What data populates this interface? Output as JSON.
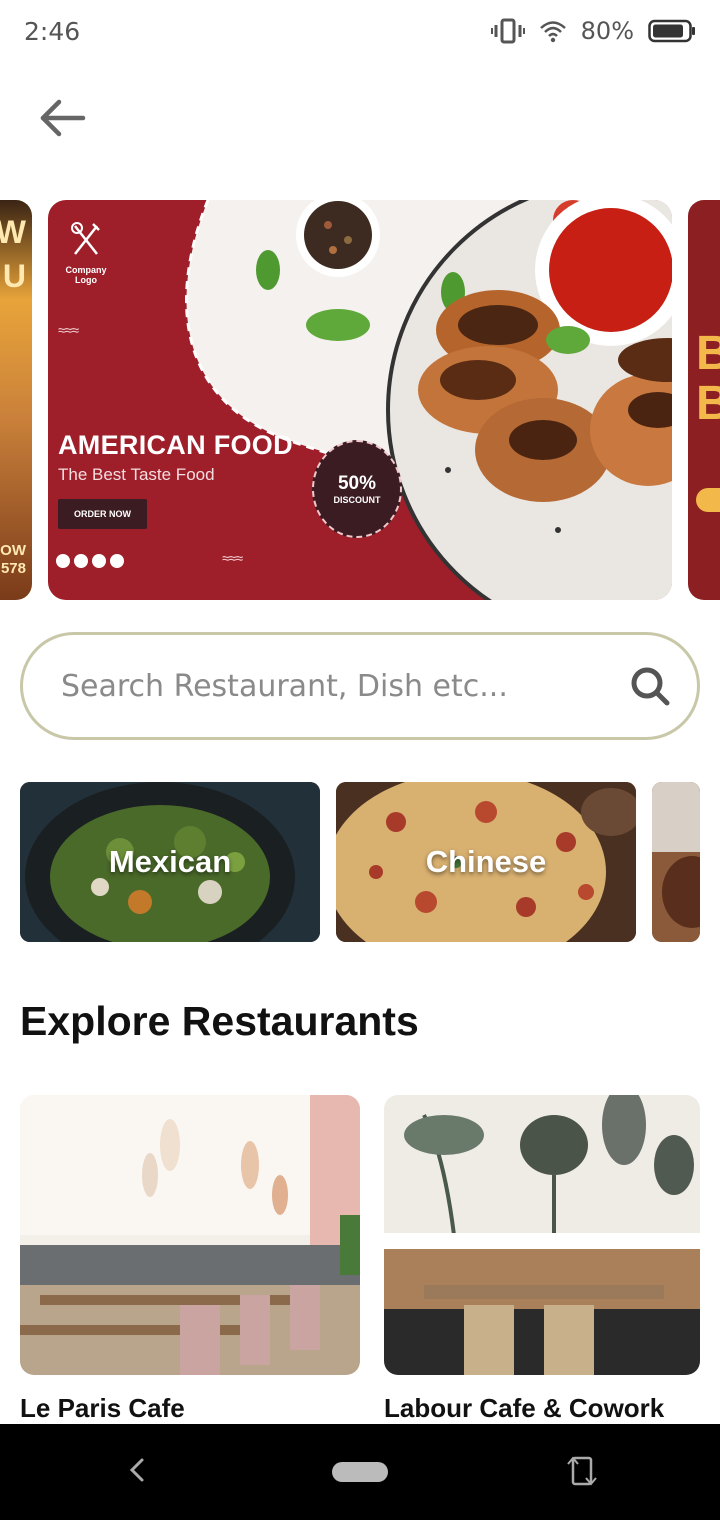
{
  "status": {
    "time": "2:46",
    "battery": "80%",
    "icons": [
      "vibrate-icon",
      "wifi-icon",
      "battery-icon"
    ]
  },
  "header": {
    "back_icon": "arrow-left-icon"
  },
  "banner": {
    "logo_text": "Company Logo",
    "title": "AMERICAN FOOD",
    "subtitle": "The Best Taste Food",
    "cta": "ORDER NOW",
    "discount_pct": "50%",
    "discount_label": "DISCOUNT",
    "peek_left_lines": [
      "W",
      "U",
      "OW",
      "578"
    ],
    "peek_right_lines": [
      "B",
      "B"
    ],
    "colors": {
      "main": "#9e1f2a",
      "dark": "#3b1c22"
    }
  },
  "search": {
    "placeholder": "Search Restaurant, Dish etc...",
    "value": ""
  },
  "categories": [
    {
      "label": "Mexican"
    },
    {
      "label": "Chinese"
    },
    {
      "label": ""
    }
  ],
  "section": {
    "title": "Explore Restaurants"
  },
  "restaurants": [
    {
      "name": "Le Paris Cafe"
    },
    {
      "name": "Labour Cafe & Cowork"
    }
  ],
  "accent": {
    "search_border": "#c8c8a8"
  }
}
